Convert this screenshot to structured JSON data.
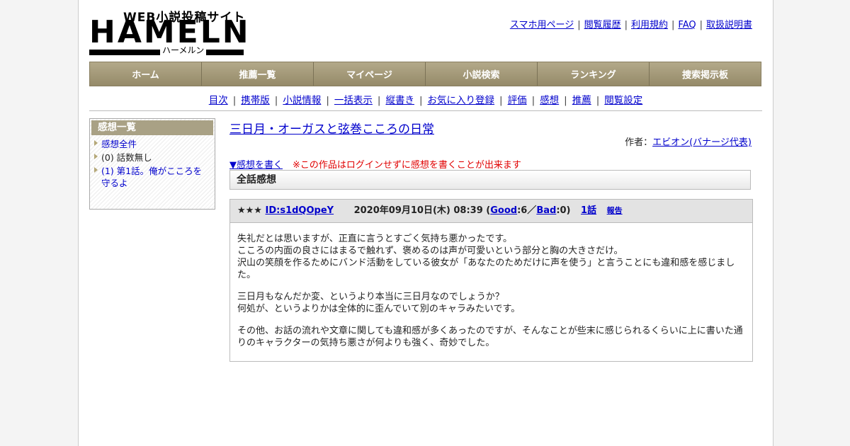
{
  "logo": {
    "sub": "WEB小説投稿サイト",
    "main": "HAMELN",
    "kana": "ハーメルン"
  },
  "top_links": [
    "スマホ用ページ",
    "閲覧履歴",
    "利用規約",
    "FAQ",
    "取扱説明書"
  ],
  "main_nav": [
    "ホーム",
    "推薦一覧",
    "マイページ",
    "小説検索",
    "ランキング",
    "捜索掲示板"
  ],
  "sub_nav": [
    "目次",
    "携帯版",
    "小説情報",
    "一括表示",
    "縦書き",
    "お気に入り登録",
    "評価",
    "感想",
    "推薦",
    "閲覧設定"
  ],
  "sidebar": {
    "title": "感想一覧",
    "items": [
      {
        "label": "感想全件"
      },
      {
        "label": "(0) 話数無し"
      },
      {
        "label": "(1) 第1話。俺がこころを守るよ"
      }
    ]
  },
  "novel": {
    "title": "三日月・オーガスと弦巻こころの日常",
    "author_label": "作者：",
    "author": "エビオン(バナージ代表)"
  },
  "write_review": {
    "link": "▼感想を書く",
    "note": "※この作品はログインせずに感想を書くことが出来ます"
  },
  "section_title": "全話感想",
  "review": {
    "stars": "★★★",
    "user_id": "ID:s1dQOpeY",
    "datetime": "2020年09月10日(木) 08:39",
    "open_paren": " (",
    "good_label": "Good",
    "good_count": ":6／",
    "bad_label": "Bad",
    "bad_count": ":0)",
    "episode": "1話",
    "report": "報告",
    "paragraphs": [
      [
        "失礼だとは思いますが、正直に言うとすごく気持ち悪かったです。",
        "こころの内面の良さにはまるで触れず、褒めるのは声が可愛いという部分と胸の大きさだけ。",
        "沢山の笑顔を作るためにバンド活動をしている彼女が「あなたのためだけに声を使う」と言うことにも違和感を感じました。"
      ],
      [
        "三日月もなんだか変、というより本当に三日月なのでしょうか？",
        "何処が、というよりかは全体的に歪んでいて別のキャラみたいです。"
      ],
      [
        "その他、お話の流れや文章に関しても違和感が多くあったのですが、そんなことが些末に感じられるくらいに上に書いた通りのキャラクターの気持ち悪さが何よりも強く、奇妙でした。"
      ]
    ]
  }
}
